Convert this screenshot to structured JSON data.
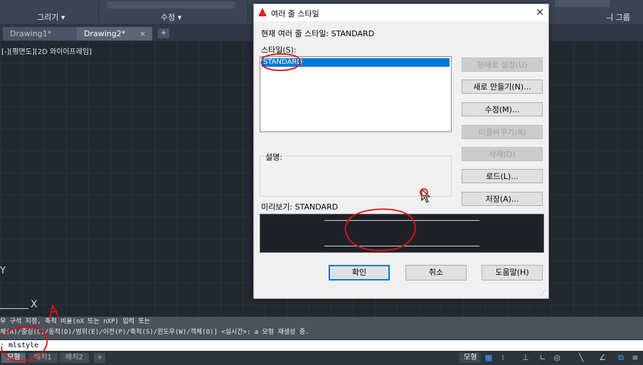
{
  "ribbon": {
    "panels": [
      {
        "label": "그리기 ▾"
      },
      {
        "label": "수정 ▾"
      },
      {
        "label": "ㅢ 그룹"
      }
    ]
  },
  "tabs": [
    {
      "label": "Drawing1*"
    },
    {
      "label": "Drawing2*"
    }
  ],
  "tab_close": "×",
  "tab_add": "+",
  "viewport_label": "[-][평면도][2D 와이어프레임]",
  "canvas": {
    "y_axis": "Y",
    "x_axis": "X"
  },
  "command": {
    "history": [
      "우 구석 지정, 축척 비율(nX 또는 nXP) 입력 또는",
      "체(A)/중심(C)/동적(D)/범위(E)/이전(P)/축척(S)/윈도우(W)/객체(O)] <실시간>: a 모형 재생성 중."
    ],
    "input": ": mlstyle"
  },
  "layout_tabs": [
    "모형",
    "배치1",
    "배치2"
  ],
  "layout_add": "+",
  "status": {
    "model": "모형",
    "icons": [
      "grid-icon",
      "snap-icon",
      "ortho-icon",
      "polar-icon",
      "osnap-icon",
      "lineweight-icon",
      "annotation-icon"
    ]
  },
  "dialog": {
    "title": "여러 줄 스타일",
    "close": "✕",
    "current_style": "현재 여러 줄 스타일: STANDARD",
    "styles_label": "스타일(S):",
    "styles": [
      "STANDARD"
    ],
    "description_label": "설명:",
    "preview_label": "미리보기: STANDARD",
    "buttons": {
      "set_current": "현재로 설정(U)",
      "new": "새로 만들기(N)...",
      "modify": "수정(M)...",
      "rename": "이름바꾸기(R)",
      "delete": "삭제(D)",
      "load": "로드(L)...",
      "save": "저장(A)..."
    },
    "ok": "확인",
    "cancel": "취소",
    "help": "도움말(H)"
  },
  "colors": {
    "accent": "#0078d7",
    "annotation": "#e01010",
    "canvas": "#212830"
  }
}
